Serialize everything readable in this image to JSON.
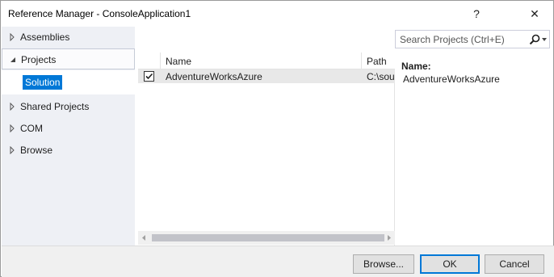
{
  "window": {
    "title": "Reference Manager - ConsoleApplication1",
    "help_label": "?",
    "close_label": "✕"
  },
  "sidebar": {
    "items": [
      {
        "label": "Assemblies",
        "expanded": false
      },
      {
        "label": "Projects",
        "expanded": true,
        "selected": true
      },
      {
        "label": "Shared Projects",
        "expanded": false
      },
      {
        "label": "COM",
        "expanded": false
      },
      {
        "label": "Browse",
        "expanded": false
      }
    ],
    "sub_item": {
      "label": "Solution",
      "selected": true
    }
  },
  "search": {
    "placeholder": "Search Projects (Ctrl+E)",
    "value": ""
  },
  "grid": {
    "columns": [
      "Name",
      "Path"
    ],
    "rows": [
      {
        "checked": true,
        "name": "AdventureWorksAzure",
        "path": "C:\\sou"
      }
    ]
  },
  "details": {
    "label": "Name:",
    "value": "AdventureWorksAzure"
  },
  "footer": {
    "browse_label": "Browse...",
    "ok_label": "OK",
    "cancel_label": "Cancel"
  },
  "colors": {
    "selection": "#0078d7",
    "sidebar_bg": "#eef0f5",
    "footer_bg": "#f0f0f0"
  }
}
